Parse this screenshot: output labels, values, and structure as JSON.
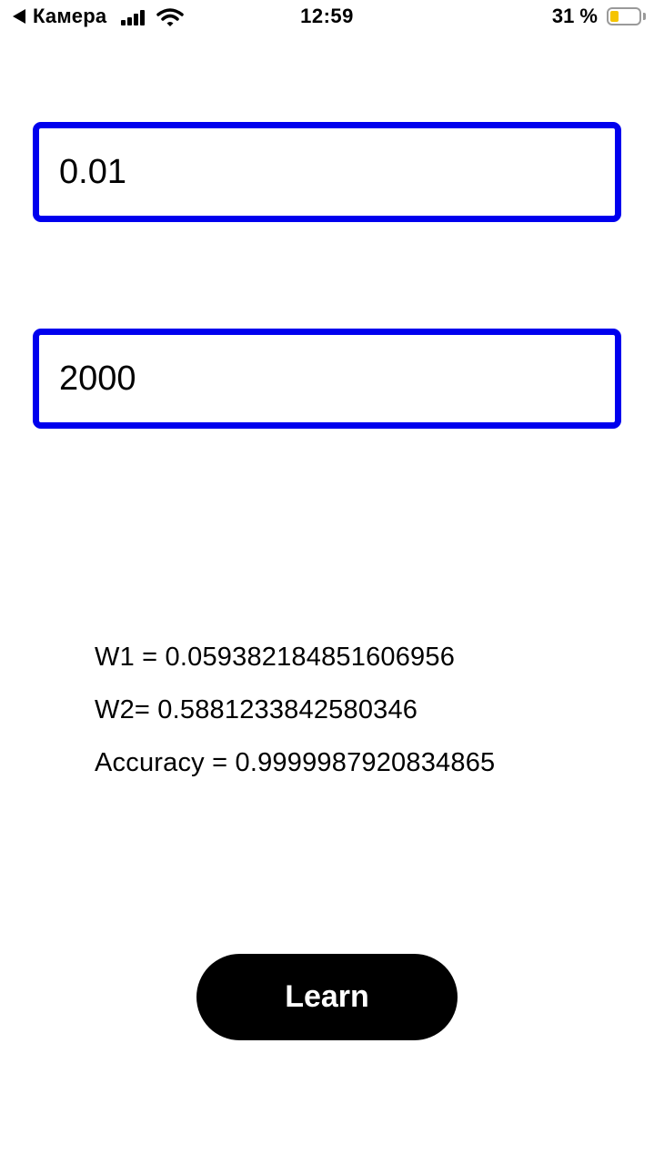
{
  "status_bar": {
    "back_label": "Камера",
    "time": "12:59",
    "battery_percent": "31 %",
    "battery_level": 0.31,
    "icons": [
      "back-arrow-icon",
      "signal-icon",
      "wifi-icon",
      "battery-icon"
    ]
  },
  "inputs": {
    "learning_rate": {
      "value": "0.01"
    },
    "epochs": {
      "value": "2000"
    }
  },
  "results": {
    "w1": "W1 = 0.059382184851606956",
    "w2": "W2= 0.5881233842580346",
    "accuracy": "Accuracy = 0.9999987920834865"
  },
  "learn_button": {
    "label": "Learn"
  },
  "colors": {
    "field_border": "#0000ee",
    "button_bg": "#000000",
    "button_text": "#ffffff",
    "battery_fill": "#f5c400"
  }
}
